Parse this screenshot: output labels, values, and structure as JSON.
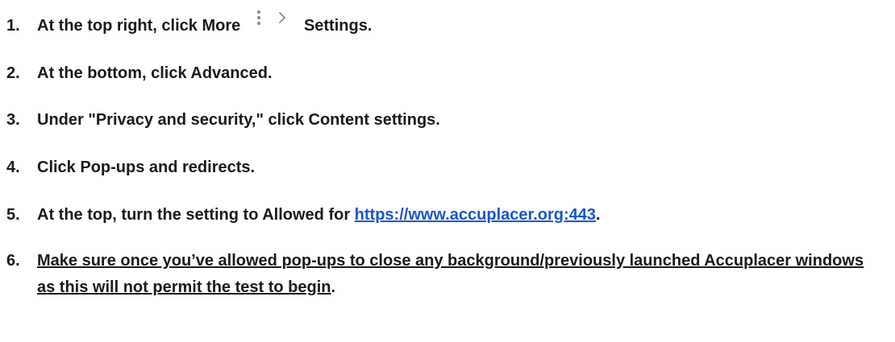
{
  "steps": [
    {
      "num": "1.",
      "before": "At the top right, click More",
      "after": "Settings."
    },
    {
      "num": "2.",
      "text": "At the bottom, click Advanced."
    },
    {
      "num": "3.",
      "text": "Under \"Privacy and security,\" click Content settings."
    },
    {
      "num": "4.",
      "text": "Click Pop-ups and redirects."
    },
    {
      "num": "5.",
      "before": "At the top, turn the setting to Allowed for ",
      "link": "https://www.accuplacer.org:443",
      "after": "."
    },
    {
      "num": "6.",
      "text": "Make sure once you’ve allowed pop-ups to close any background/previously launched Accuplacer windows as this will not permit the test to begin",
      "after": "."
    }
  ],
  "icons": {
    "more": "more-vertical-icon",
    "chevron": "chevron-right-icon"
  },
  "colors": {
    "text": "#1a1a1a",
    "link": "#1a56c9",
    "icon": "#8a8a8a"
  }
}
